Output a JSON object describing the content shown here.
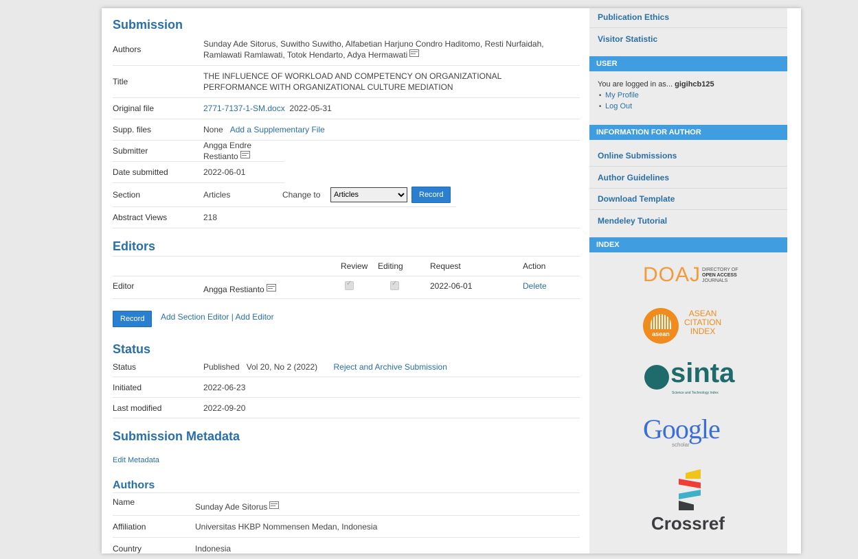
{
  "submission": {
    "heading": "Submission",
    "authors_label": "Authors",
    "authors_line1": "Sunday Ade Sitorus, Suwitho Suwitho, Alfabetian Harjuno Condro Haditomo, Resti Nurfaidah,",
    "authors_line2": "Ramlawati Ramlawati, Totok Hendarto, Adya Hermawati",
    "title_label": "Title",
    "title_line1": "THE INFLUENCE OF WORKLOAD AND COMPETENCY ON ORGANIZATIONAL",
    "title_line2": "PERFORMANCE WITH ORGANIZATIONAL CULTURE MEDIATION",
    "original_file_label": "Original file",
    "original_file_name": "2771-7137-1-SM.docx",
    "original_file_date": "2022-05-31",
    "supp_files_label": "Supp. files",
    "supp_files_value": "None",
    "supp_files_add": "Add a Supplementary File",
    "submitter_label": "Submitter",
    "submitter_value": "Angga Endre Restianto",
    "date_submitted_label": "Date submitted",
    "date_submitted_value": "2022-06-01",
    "section_label": "Section",
    "section_value": "Articles",
    "change_to_label": "Change to",
    "section_select_value": "Articles",
    "record_label": "Record",
    "abstract_views_label": "Abstract Views",
    "abstract_views_value": "218"
  },
  "editors": {
    "heading": "Editors",
    "col_review": "Review",
    "col_editing": "Editing",
    "col_request": "Request",
    "col_action": "Action",
    "row_role": "Editor",
    "row_name": "Angga Restianto",
    "row_request": "2022-06-01",
    "row_action": "Delete",
    "record_label": "Record",
    "add_section_editor": "Add Section Editor",
    "separator": "|",
    "add_editor": "Add Editor"
  },
  "status": {
    "heading": "Status",
    "status_label": "Status",
    "status_value": "Published",
    "issue_value": "Vol 20, No 2 (2022)",
    "reject_link": "Reject and Archive Submission",
    "initiated_label": "Initiated",
    "initiated_value": "2022-06-23",
    "last_modified_label": "Last modified",
    "last_modified_value": "2022-09-20"
  },
  "metadata": {
    "heading": "Submission Metadata",
    "edit_link": "Edit Metadata",
    "authors_heading": "Authors",
    "name_label": "Name",
    "name_value": "Sunday Ade Sitorus",
    "affiliation_label": "Affiliation",
    "affiliation_value": "Universitas HKBP Nommensen Medan, Indonesia",
    "country_label": "Country",
    "country_value": "Indonesia"
  },
  "sidebar": {
    "publication_ethics": "Publication Ethics",
    "visitor_statistic": "Visitor Statistic",
    "user_heading": "USER",
    "logged_in_prefix": "You are logged in as...",
    "username": "gigihcb125",
    "my_profile": "My Profile",
    "log_out": "Log Out",
    "info_heading": "INFORMATION FOR AUTHOR",
    "online_submissions": "Online Submissions",
    "author_guidelines": "Author Guidelines",
    "download_template": "Download Template",
    "mendeley_tutorial": "Mendeley Tutorial",
    "index_heading": "INDEX"
  },
  "logos": {
    "doaj": "DOAJ",
    "doaj_line1": "DIRECTORY OF",
    "doaj_line2": "OPEN ACCESS",
    "doaj_line3": "JOURNALS",
    "asean_line1": "ASEAN",
    "asean_line2": "CITATION",
    "asean_line3": "INDEX",
    "asean_badge": "asean",
    "sinta": "sinta",
    "sinta_sub": "Science and Technology Index",
    "google": "Google",
    "google_sub": "scholar",
    "crossref": "Crossref"
  },
  "colors": {
    "link": "#2a6fa8",
    "sidebar_header": "#3f9de0",
    "button": "#2a7fd0"
  }
}
